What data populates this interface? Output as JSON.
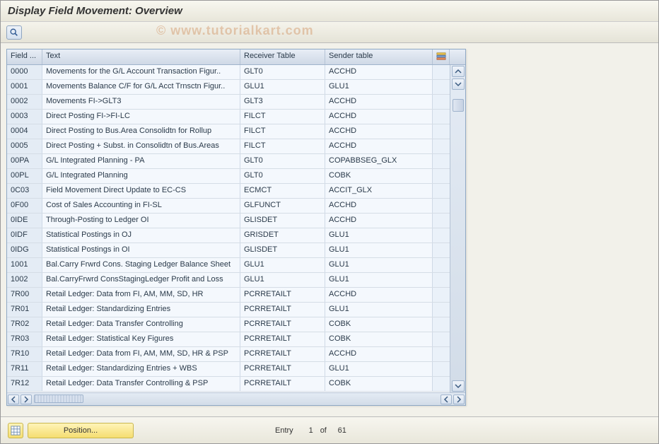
{
  "title": "Display Field Movement: Overview",
  "watermark": "© www.tutorialkart.com",
  "columns": {
    "field": "Field ...",
    "text": "Text",
    "receiver": "Receiver Table",
    "sender": "Sender table"
  },
  "rows": [
    {
      "field": "0000",
      "text": "Movements for the G/L Account Transaction Figur..",
      "receiver": "GLT0",
      "sender": "ACCHD"
    },
    {
      "field": "0001",
      "text": "Movements Balance C/F for G/L Acct Trnsctn Figur..",
      "receiver": "GLU1",
      "sender": "GLU1"
    },
    {
      "field": "0002",
      "text": "Movements FI->GLT3",
      "receiver": "GLT3",
      "sender": "ACCHD"
    },
    {
      "field": "0003",
      "text": "Direct Posting FI->FI-LC",
      "receiver": "FILCT",
      "sender": "ACCHD"
    },
    {
      "field": "0004",
      "text": "Direct Posting to Bus.Area Consolidtn for Rollup",
      "receiver": "FILCT",
      "sender": "ACCHD"
    },
    {
      "field": "0005",
      "text": "Direct Posting + Subst. in Consolidtn of Bus.Areas",
      "receiver": "FILCT",
      "sender": "ACCHD"
    },
    {
      "field": "00PA",
      "text": "G/L Integrated Planning - PA",
      "receiver": "GLT0",
      "sender": "COPABBSEG_GLX"
    },
    {
      "field": "00PL",
      "text": "G/L Integrated Planning",
      "receiver": "GLT0",
      "sender": "COBK"
    },
    {
      "field": "0C03",
      "text": "Field Movement Direct Update to EC-CS",
      "receiver": "ECMCT",
      "sender": "ACCIT_GLX"
    },
    {
      "field": "0F00",
      "text": "Cost of Sales Accounting in FI-SL",
      "receiver": "GLFUNCT",
      "sender": "ACCHD"
    },
    {
      "field": "0IDE",
      "text": "Through-Posting to Ledger OI",
      "receiver": "GLISDET",
      "sender": "ACCHD"
    },
    {
      "field": "0IDF",
      "text": "Statistical Postings in OJ",
      "receiver": "GRISDET",
      "sender": "GLU1"
    },
    {
      "field": "0IDG",
      "text": "Statistical Postings in OI",
      "receiver": "GLISDET",
      "sender": "GLU1"
    },
    {
      "field": "1001",
      "text": "Bal.Carry Frwrd Cons. Staging Ledger Balance Sheet",
      "receiver": "GLU1",
      "sender": "GLU1"
    },
    {
      "field": "1002",
      "text": "Bal.CarryFrwrd ConsStagingLedger Profit and Loss",
      "receiver": "GLU1",
      "sender": "GLU1"
    },
    {
      "field": "7R00",
      "text": "Retail Ledger: Data from FI, AM, MM, SD, HR",
      "receiver": "PCRRETAILT",
      "sender": "ACCHD"
    },
    {
      "field": "7R01",
      "text": "Retail Ledger: Standardizing Entries",
      "receiver": "PCRRETAILT",
      "sender": "GLU1"
    },
    {
      "field": "7R02",
      "text": "Retail Ledger: Data Transfer Controlling",
      "receiver": "PCRRETAILT",
      "sender": "COBK"
    },
    {
      "field": "7R03",
      "text": "Retail Ledger: Statistical Key Figures",
      "receiver": "PCRRETAILT",
      "sender": "COBK"
    },
    {
      "field": "7R10",
      "text": "Retail Ledger: Data from FI, AM, MM, SD, HR & PSP",
      "receiver": "PCRRETAILT",
      "sender": "ACCHD"
    },
    {
      "field": "7R11",
      "text": "Retail Ledger: Standardizing Entries + WBS",
      "receiver": "PCRRETAILT",
      "sender": "GLU1"
    },
    {
      "field": "7R12",
      "text": "Retail Ledger: Data Transfer Controlling & PSP",
      "receiver": "PCRRETAILT",
      "sender": "COBK"
    }
  ],
  "footer": {
    "position_label": "Position...",
    "entry_label": "Entry",
    "of_label": "of",
    "current": "1",
    "total": "61"
  }
}
